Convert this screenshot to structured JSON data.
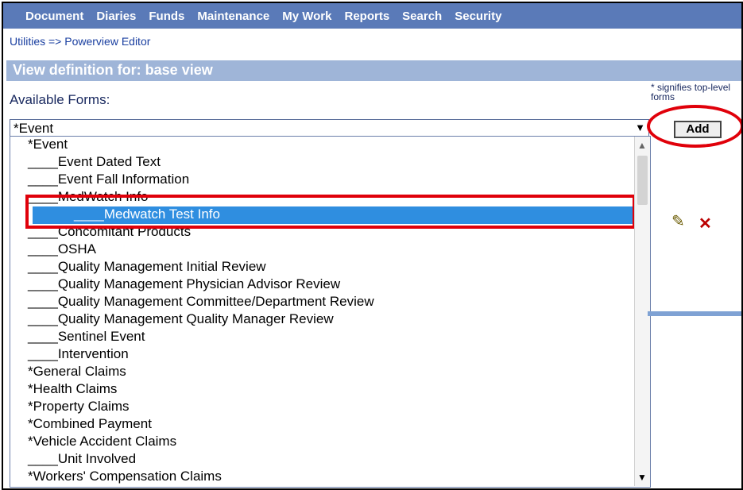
{
  "menu": [
    "Document",
    "Diaries",
    "Funds",
    "Maintenance",
    "My Work",
    "Reports",
    "Search",
    "Security"
  ],
  "breadcrumb": "Utilities => Powerview Editor",
  "section_title": "View definition for: base view",
  "available_forms_label": "Available Forms:",
  "signifies_note": "* signifies top-level forms",
  "select": {
    "value": "*Event",
    "arrow": "▼"
  },
  "add_label": "Add",
  "options": [
    "*Event",
    "____Event Dated Text",
    "____Event Fall Information",
    "____MedWatch Info",
    "____Medwatch Test Info",
    "____Concomitant Products",
    "____OSHA",
    "____Quality Management Initial Review",
    "____Quality Management Physician Advisor Review",
    "____Quality Management Committee/Department Review",
    "____Quality Management Quality Manager Review",
    "____Sentinel Event",
    "____Intervention",
    "*General Claims",
    "*Health Claims",
    "*Property Claims",
    "*Combined Payment",
    "*Vehicle Accident Claims",
    "____Unit Involved",
    "*Workers' Compensation Claims"
  ],
  "selected_index": 4,
  "icons": {
    "edit": "pencil-icon",
    "delete": "delete-x-icon",
    "scroll_up": "▲",
    "scroll_down": "▼"
  }
}
